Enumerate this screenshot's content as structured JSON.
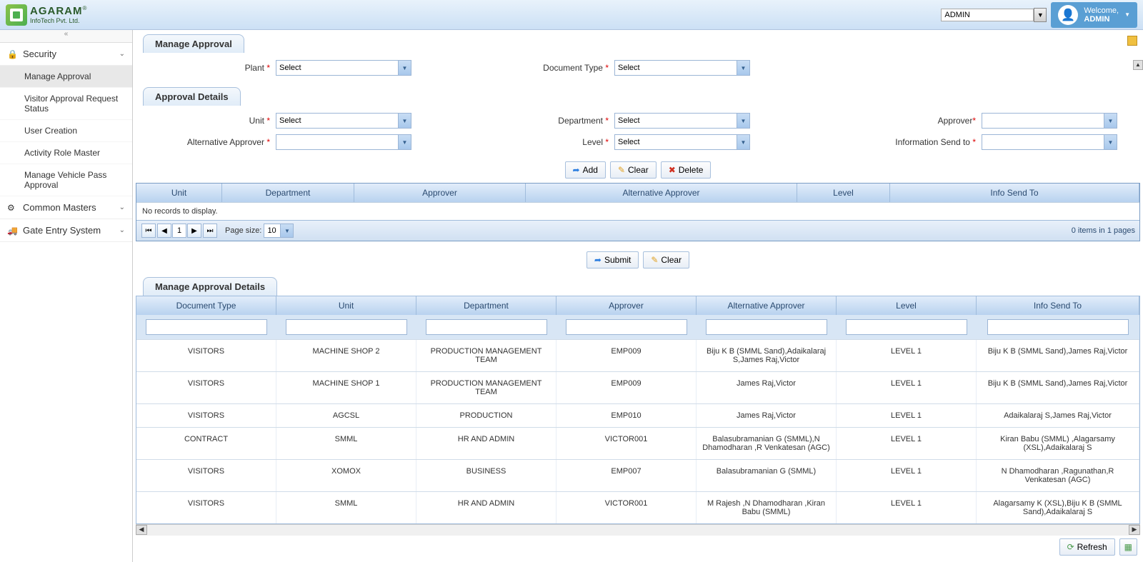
{
  "header": {
    "logo_title": "AGARAM",
    "logo_sub": "InfoTech Pvt. Ltd.",
    "user_select": "ADMIN",
    "welcome": "Welcome,",
    "username": "ADMIN"
  },
  "sidebar": {
    "sections": [
      {
        "title": "Security",
        "icon": "lock",
        "items": [
          "Manage Approval",
          "Visitor Approval Request Status",
          "User Creation",
          "Activity Role Master",
          "Manage Vehicle Pass Approval"
        ]
      },
      {
        "title": "Common Masters",
        "icon": "gear",
        "items": []
      },
      {
        "title": "Gate Entry System",
        "icon": "truck",
        "items": []
      }
    ]
  },
  "page": {
    "title": "Manage Approval",
    "section_approval": "Approval Details",
    "section_details": "Manage Approval Details",
    "labels": {
      "plant": "Plant",
      "doctype": "Document Type",
      "unit": "Unit",
      "department": "Department",
      "approver": "Approver",
      "alt_approver": "Alternative Approver",
      "level": "Level",
      "info_send": "Information Send to"
    },
    "select_default": "Select",
    "buttons": {
      "add": "Add",
      "clear": "Clear",
      "delete": "Delete",
      "submit": "Submit",
      "refresh": "Refresh"
    },
    "grid1": {
      "headers": [
        "Unit",
        "Department",
        "Approver",
        "Alternative Approver",
        "Level",
        "Info Send To"
      ],
      "empty": "No records to display.",
      "page_size_label": "Page size:",
      "page_size": "10",
      "page": "1",
      "info": "0 items in 1 pages"
    },
    "grid2": {
      "headers": [
        "Document Type",
        "Unit",
        "Department",
        "Approver",
        "Alternative Approver",
        "Level",
        "Info Send To"
      ],
      "rows": [
        {
          "c1": "VISITORS",
          "c2": "MACHINE SHOP 2",
          "c3": "PRODUCTION MANAGEMENT TEAM",
          "c4": "EMP009",
          "c5": "Biju K B (SMML Sand),Adaikalaraj S,James Raj,Victor",
          "c6": "LEVEL 1",
          "c7": "Biju K B (SMML Sand),James Raj,Victor"
        },
        {
          "c1": "VISITORS",
          "c2": "MACHINE SHOP 1",
          "c3": "PRODUCTION MANAGEMENT TEAM",
          "c4": "EMP009",
          "c5": "James Raj,Victor",
          "c6": "LEVEL 1",
          "c7": "Biju K B (SMML Sand),James Raj,Victor"
        },
        {
          "c1": "VISITORS",
          "c2": "AGCSL",
          "c3": "PRODUCTION",
          "c4": "EMP010",
          "c5": "James Raj,Victor",
          "c6": "LEVEL 1",
          "c7": "Adaikalaraj S,James Raj,Victor"
        },
        {
          "c1": "CONTRACT",
          "c2": "SMML",
          "c3": "HR AND ADMIN",
          "c4": "VICTOR001",
          "c5": "Balasubramanian G (SMML),N Dhamodharan ,R Venkatesan (AGC)",
          "c6": "LEVEL 1",
          "c7": "Kiran Babu (SMML) ,Alagarsamy (XSL),Adaikalaraj S"
        },
        {
          "c1": "VISITORS",
          "c2": "XOMOX",
          "c3": "BUSINESS",
          "c4": "EMP007",
          "c5": "Balasubramanian G (SMML)",
          "c6": "LEVEL 1",
          "c7": "N Dhamodharan ,Ragunathan,R Venkatesan (AGC)"
        },
        {
          "c1": "VISITORS",
          "c2": "SMML",
          "c3": "HR AND ADMIN",
          "c4": "VICTOR001",
          "c5": "M Rajesh ,N Dhamodharan ,Kiran Babu (SMML)",
          "c6": "LEVEL 1",
          "c7": "Alagarsamy K (XSL),Biju K B (SMML Sand),Adaikalaraj S"
        }
      ]
    }
  }
}
